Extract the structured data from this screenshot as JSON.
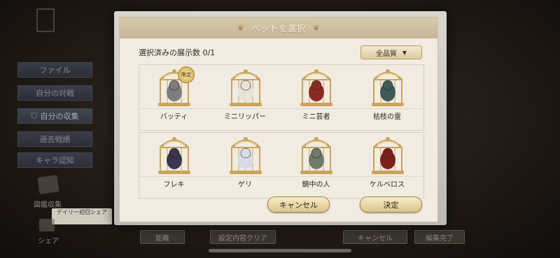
{
  "background": {
    "side_menu": [
      {
        "label": "ファイル",
        "selected": false
      },
      {
        "label": "自分の対戦",
        "selected": false
      },
      {
        "label": "自分の収集",
        "selected": true
      },
      {
        "label": "過去戦績",
        "selected": false
      },
      {
        "label": "キャラ認知",
        "selected": false
      }
    ],
    "collection_caption": "図鑑収集",
    "daily_label": "デイリー初回シェア",
    "share_label": "シェア",
    "bottom_buttons": [
      "距離",
      "設定内容クリア",
      "キャンセル",
      "編集完了"
    ]
  },
  "dialog": {
    "title": "ペットを選択",
    "counter_label": "選択済みの展示数 0/1",
    "quality_select": "全品質",
    "limited_badge": "限定",
    "pets": [
      {
        "name": "バッティ",
        "limited": true,
        "color": "#7d7d7d"
      },
      {
        "name": "ミニリッパー",
        "limited": false,
        "color": "#e8e2d8"
      },
      {
        "name": "ミニ芸者",
        "limited": false,
        "color": "#8b2a22"
      },
      {
        "name": "枯枝の霊",
        "limited": false,
        "color": "#3f5a57"
      },
      {
        "name": "フレキ",
        "limited": false,
        "color": "#3b3550"
      },
      {
        "name": "ゲリ",
        "limited": false,
        "color": "#d9dde3"
      },
      {
        "name": "鏡中の人",
        "limited": false,
        "color": "#6f7a6a"
      },
      {
        "name": "ケルベロス",
        "limited": false,
        "color": "#7b1f1a"
      }
    ],
    "cancel_label": "キャンセル",
    "confirm_label": "決定"
  },
  "colors": {
    "header": "#cdbb9c",
    "panel": "#f1ece2",
    "button": "#e9d6a6",
    "cage_gold": "#c9a35b"
  }
}
